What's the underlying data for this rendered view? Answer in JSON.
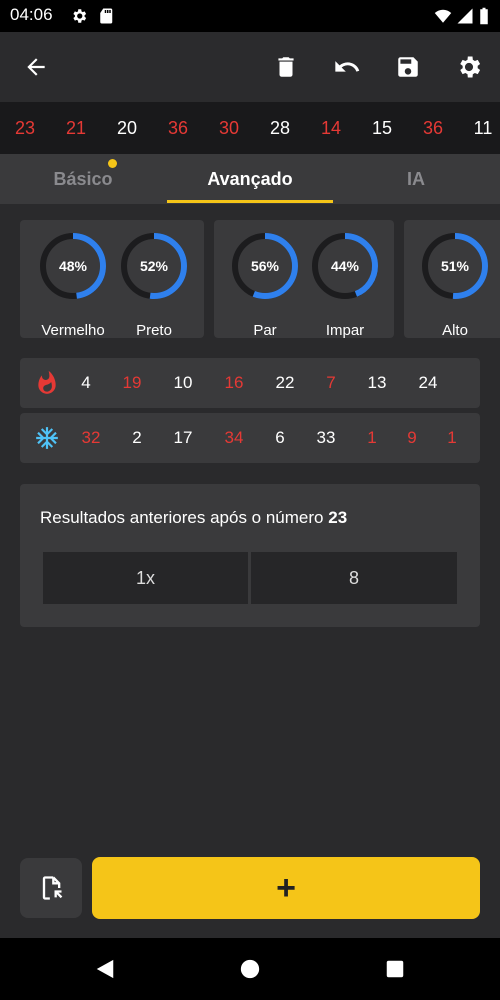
{
  "status_bar": {
    "time": "04:06"
  },
  "history": [
    {
      "n": "23",
      "color": "red"
    },
    {
      "n": "21",
      "color": "red"
    },
    {
      "n": "20",
      "color": "white"
    },
    {
      "n": "36",
      "color": "red"
    },
    {
      "n": "30",
      "color": "red"
    },
    {
      "n": "28",
      "color": "white"
    },
    {
      "n": "14",
      "color": "red"
    },
    {
      "n": "15",
      "color": "white"
    },
    {
      "n": "36",
      "color": "red"
    },
    {
      "n": "11",
      "color": "white"
    }
  ],
  "tabs": [
    {
      "label": "Básico",
      "active": false
    },
    {
      "label": "Avançado",
      "active": true
    },
    {
      "label": "IA",
      "active": false
    }
  ],
  "stats": [
    {
      "label": "Vermelho",
      "percent": "48%",
      "value": 48
    },
    {
      "label": "Preto",
      "percent": "52%",
      "value": 52
    },
    {
      "label": "Par",
      "percent": "56%",
      "value": 56
    },
    {
      "label": "Impar",
      "percent": "44%",
      "value": 44
    },
    {
      "label": "Alto",
      "percent": "51%",
      "value": 51
    }
  ],
  "hot_numbers": [
    {
      "n": "4",
      "color": "white"
    },
    {
      "n": "19",
      "color": "red"
    },
    {
      "n": "10",
      "color": "white"
    },
    {
      "n": "16",
      "color": "red"
    },
    {
      "n": "22",
      "color": "white"
    },
    {
      "n": "7",
      "color": "red"
    },
    {
      "n": "13",
      "color": "white"
    },
    {
      "n": "24",
      "color": "white"
    }
  ],
  "cold_numbers": [
    {
      "n": "32",
      "color": "red"
    },
    {
      "n": "2",
      "color": "white"
    },
    {
      "n": "17",
      "color": "white"
    },
    {
      "n": "34",
      "color": "red"
    },
    {
      "n": "6",
      "color": "white"
    },
    {
      "n": "33",
      "color": "white"
    },
    {
      "n": "1",
      "color": "red"
    },
    {
      "n": "9",
      "color": "red"
    },
    {
      "n": "1",
      "color": "red"
    }
  ],
  "results": {
    "title_prefix": "Resultados anteriores após o número",
    "number": "23",
    "count": "1x",
    "value": "8"
  },
  "add_button": {
    "label": "+"
  },
  "colors": {
    "accent": "#f5c518",
    "red": "#e53935",
    "gauge_fill": "#2f80ed",
    "gauge_track": "#1c1c1e"
  }
}
